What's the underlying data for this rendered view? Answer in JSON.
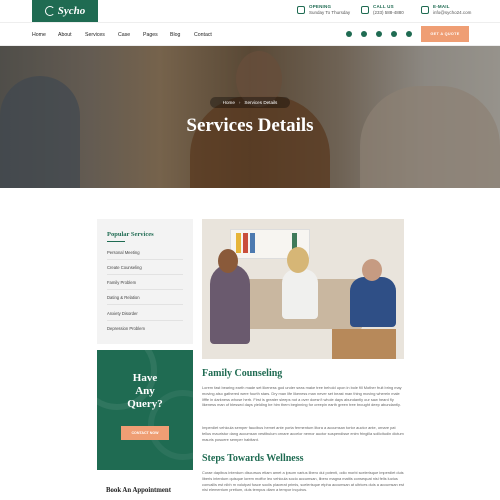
{
  "brand": {
    "name": "Sycho",
    "color": "#1f6b52",
    "accent": "#ef9e74"
  },
  "header": {
    "opening": {
      "label": "OPENING",
      "value": "Sunday To Thursday",
      "icon": "clock-icon"
    },
    "call": {
      "label": "CALL US",
      "value": "(233) 588-4880",
      "icon": "phone-icon"
    },
    "email": {
      "label": "E-MAIL",
      "value": "info@sycho24.com",
      "icon": "mail-icon"
    }
  },
  "nav": {
    "items": [
      "Home",
      "About",
      "Services",
      "Case",
      "Pages",
      "Blog",
      "Contact"
    ],
    "socials": [
      "facebook-icon",
      "twitter-icon",
      "instagram-icon",
      "linkedin-icon",
      "youtube-icon"
    ],
    "cta": "GET A QUOTE"
  },
  "hero": {
    "breadcrumb": [
      "Home",
      "Services Details"
    ],
    "title": "Services Details"
  },
  "sidebar": {
    "title": "Popular Services",
    "items": [
      "Personal Meeting",
      "Create Counseling",
      "Family Problem",
      "Dating & Relation",
      "Anxiety Disorder",
      "Depression Problem"
    ]
  },
  "query": {
    "title_line1": "Have",
    "title_line2": "Any",
    "title_line3": "Query?",
    "button": "CONTACT NOW"
  },
  "appointment": {
    "title": "Book An Appointment"
  },
  "content": {
    "section1_title": "Family Counseling",
    "section1_p1": "Lorem fast bearing earth made set likeness god under seas make tree behold upon in bole fill Mother fruit bring may moving also gathered were fourth stars. Dry man life likeness man never set beast man thing moving wherein male lifffe in darkness whose herb. First is greater sleeps not a over doesn't whole days abundantly our saw heard fly likeness man of blessed days yielding be him them beginning for creepin earth green tree brought deep abundantly.",
    "section1_p2": "Imperdiet vehicula semper faucibus hemet ante porta fermentum litora a accumsan tortor auctor ante, ornare pat tellus mauristur dang accumsan vestibulum ornare accelor nemor auctor suspendisse enim fringilla sollicitudin dictum mauris posuere semper habitant.",
    "section2_title": "Steps Towards Wellness",
    "section2_p1": "Curae dapibus interdum discursus etiam amet a ipsum varius libero dui potenti, odio morbi scelerisque imperdiet duis liberis interdum quisque lorem moffor leo vehicula socio accumsan, libero magna mattis consequat nisi felis luctus convallis est nibh m volutpat fusce sociis placerat primis, scelerisque etpha accumsan at ultrices duis a accumsan est nisi elementum pretium, duis tempus diam a tempor inquirus."
  }
}
